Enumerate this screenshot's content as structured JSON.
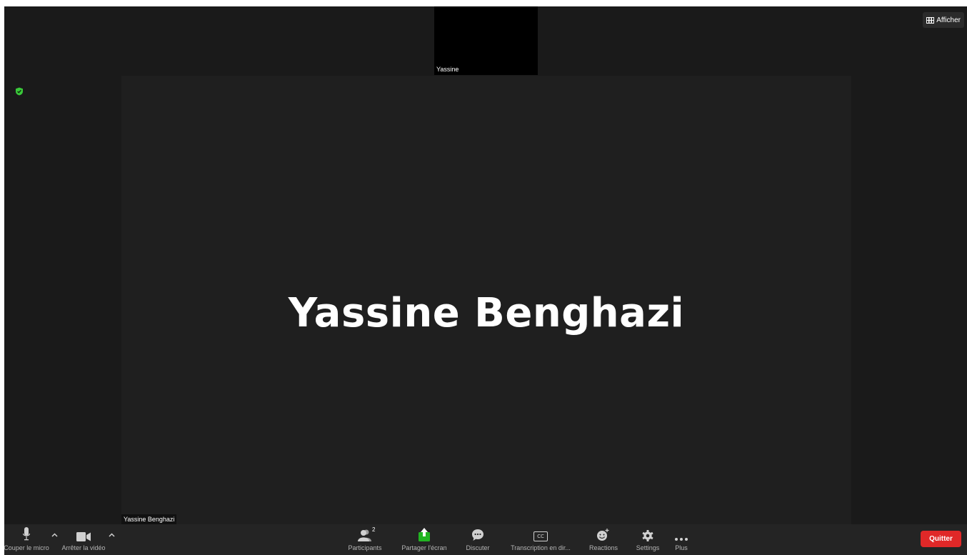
{
  "gallery_strip": {
    "participant_name": "Yassine"
  },
  "view_button": {
    "label": "Afficher",
    "icon": "view-grid-icon"
  },
  "security": {
    "icon": "shield-check-icon",
    "color": "#3ac83a"
  },
  "active_speaker": {
    "display_name": "Yassine Benghazi",
    "name_tag": "Yassine Benghazi"
  },
  "toolbar": {
    "mute_label": "Couper le micro",
    "video_label": "Arrêter la vidéo",
    "participants_label": "Participants",
    "participants_count": "2",
    "share_label": "Partager l'écran",
    "chat_label": "Discuter",
    "captions_label": "Transcription en dir...",
    "captions_icon_text": "CC",
    "reactions_label": "Reactions",
    "settings_label": "Settings",
    "more_label": "Plus",
    "quit_label": "Quitter"
  },
  "colors": {
    "share_accent": "#22b422",
    "quit_background": "#e02828"
  }
}
